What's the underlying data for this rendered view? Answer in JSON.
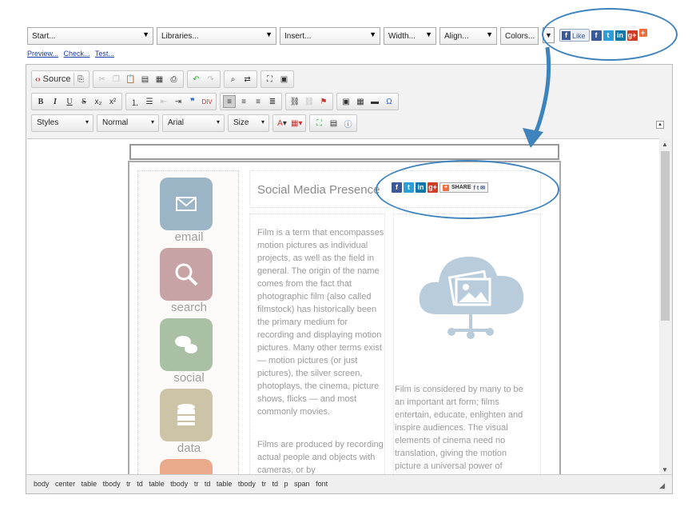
{
  "topbar": {
    "selects": [
      {
        "label": "Start...",
        "w": 158
      },
      {
        "label": "Libraries...",
        "w": 150
      },
      {
        "label": "Insert...",
        "w": 126
      },
      {
        "label": "Width...",
        "w": 66
      },
      {
        "label": "Align...",
        "w": 70
      },
      {
        "label": "Colors...",
        "w": 48
      }
    ],
    "fb_like_label": "Like",
    "social_icons": [
      "f",
      "t",
      "in",
      "g+",
      "+"
    ],
    "links": [
      "Preview...",
      "Check...",
      "Test..."
    ]
  },
  "toolbar": {
    "source_label": "Source",
    "styles_label": "Styles",
    "format_label": "Normal",
    "font_label": "Arial",
    "size_label": "Size",
    "bold": "B",
    "italic": "I",
    "underline": "U",
    "strike": "S"
  },
  "content": {
    "heading": "Social Media Presence",
    "share_label": "SHARE",
    "tiles": [
      "email",
      "search",
      "social",
      "data"
    ],
    "left_text": "Film is a term that encompasses motion pictures as individual projects, as well as the field in general. The origin of the name comes from the fact that photographic film (also called filmstock) has historically been the primary medium for recording and displaying motion pictures. Many other terms exist — motion pictures (or just pictures), the silver screen, photoplays, the cinema, picture shows, flicks — and most commonly movies.",
    "left_text2": "Films are produced by recording actual people and objects with cameras, or by",
    "right_text": "Film is considered by many to be an important art form; films entertain, educate, enlighten and inspire audiences. The visual elements of cinema need no translation, giving the motion picture a universal power of"
  },
  "statusbar": {
    "path": [
      "body",
      "center",
      "table",
      "tbody",
      "tr",
      "td",
      "table",
      "tbody",
      "tr",
      "td",
      "table",
      "tbody",
      "tr",
      "td",
      "p",
      "span",
      "font"
    ]
  },
  "colors": {
    "highlight": "#3f83bd",
    "facebook": "#3b5998",
    "twitter": "#2a9fd8",
    "linkedin": "#0e76a8",
    "google": "#d23b24"
  }
}
